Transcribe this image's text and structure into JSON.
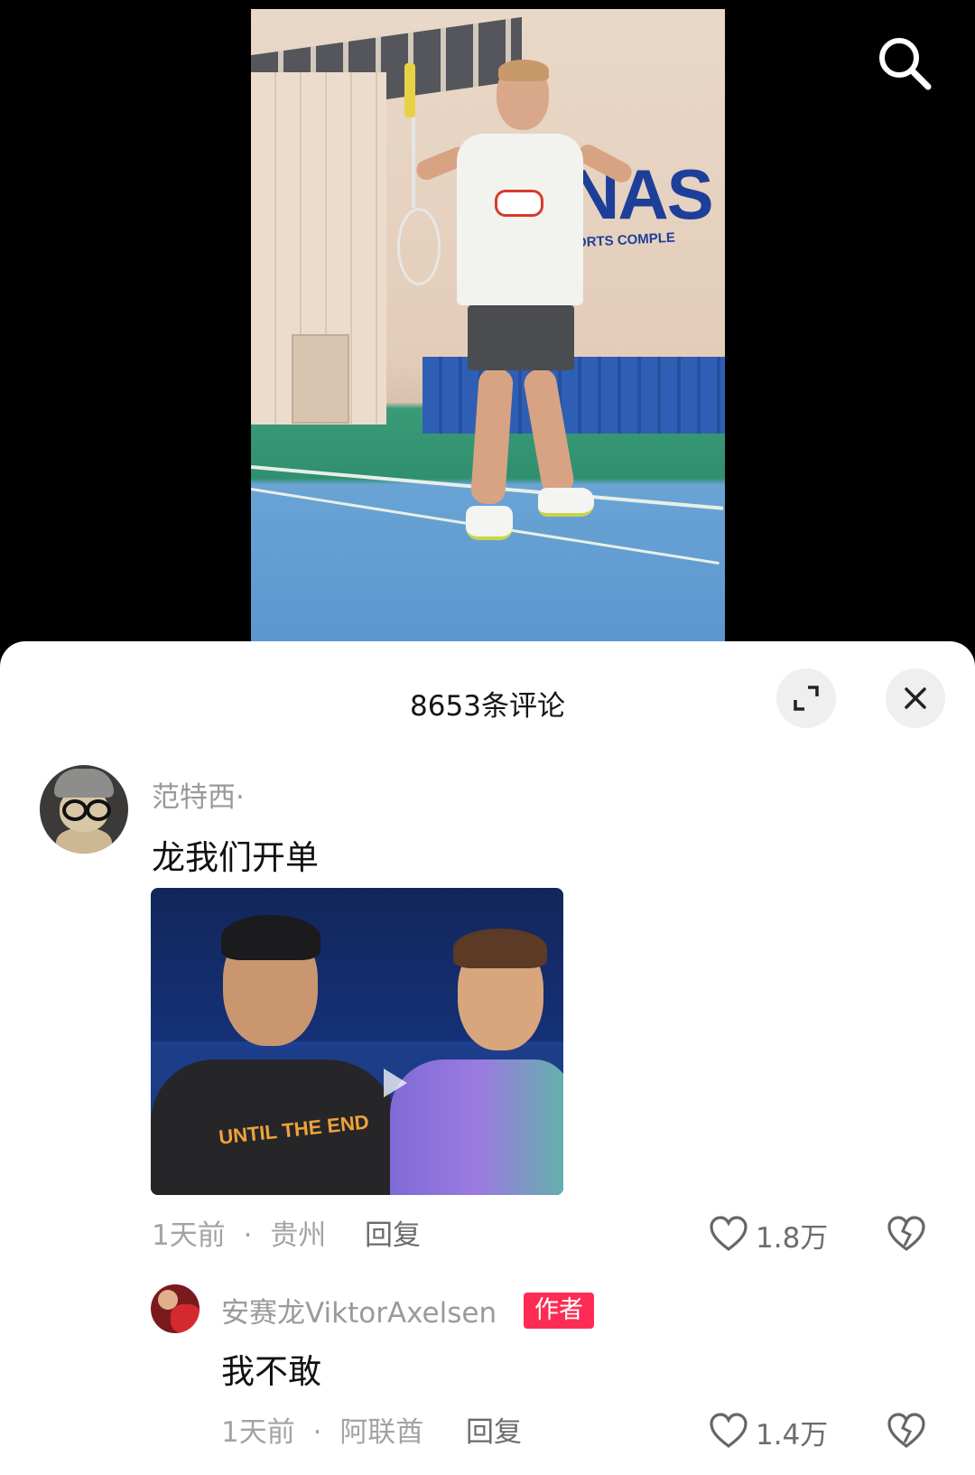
{
  "search": {
    "icon": "search-icon"
  },
  "comments_panel": {
    "title": "8653条评论",
    "expand_icon": "expand-icon",
    "close_icon": "close-icon"
  },
  "comments": [
    {
      "username": "范特西·",
      "text": "龙我们开单",
      "has_video_attachment": true,
      "time": "1天前",
      "separator": "·",
      "location": "贵州",
      "reply_label": "回复",
      "likes": "1.8万"
    },
    {
      "username": "安赛龙ViktorAxelsen",
      "badge": "作者",
      "text": "我不敢",
      "time": "1天前",
      "separator": "·",
      "location": "阿联酋",
      "reply_label": "回复",
      "likes": "1.4万"
    }
  ],
  "colors": {
    "badge": "#fe2c55",
    "username": "#9a9a9a",
    "meta": "#a3a3a3",
    "panel_bg": "#ffffff"
  }
}
